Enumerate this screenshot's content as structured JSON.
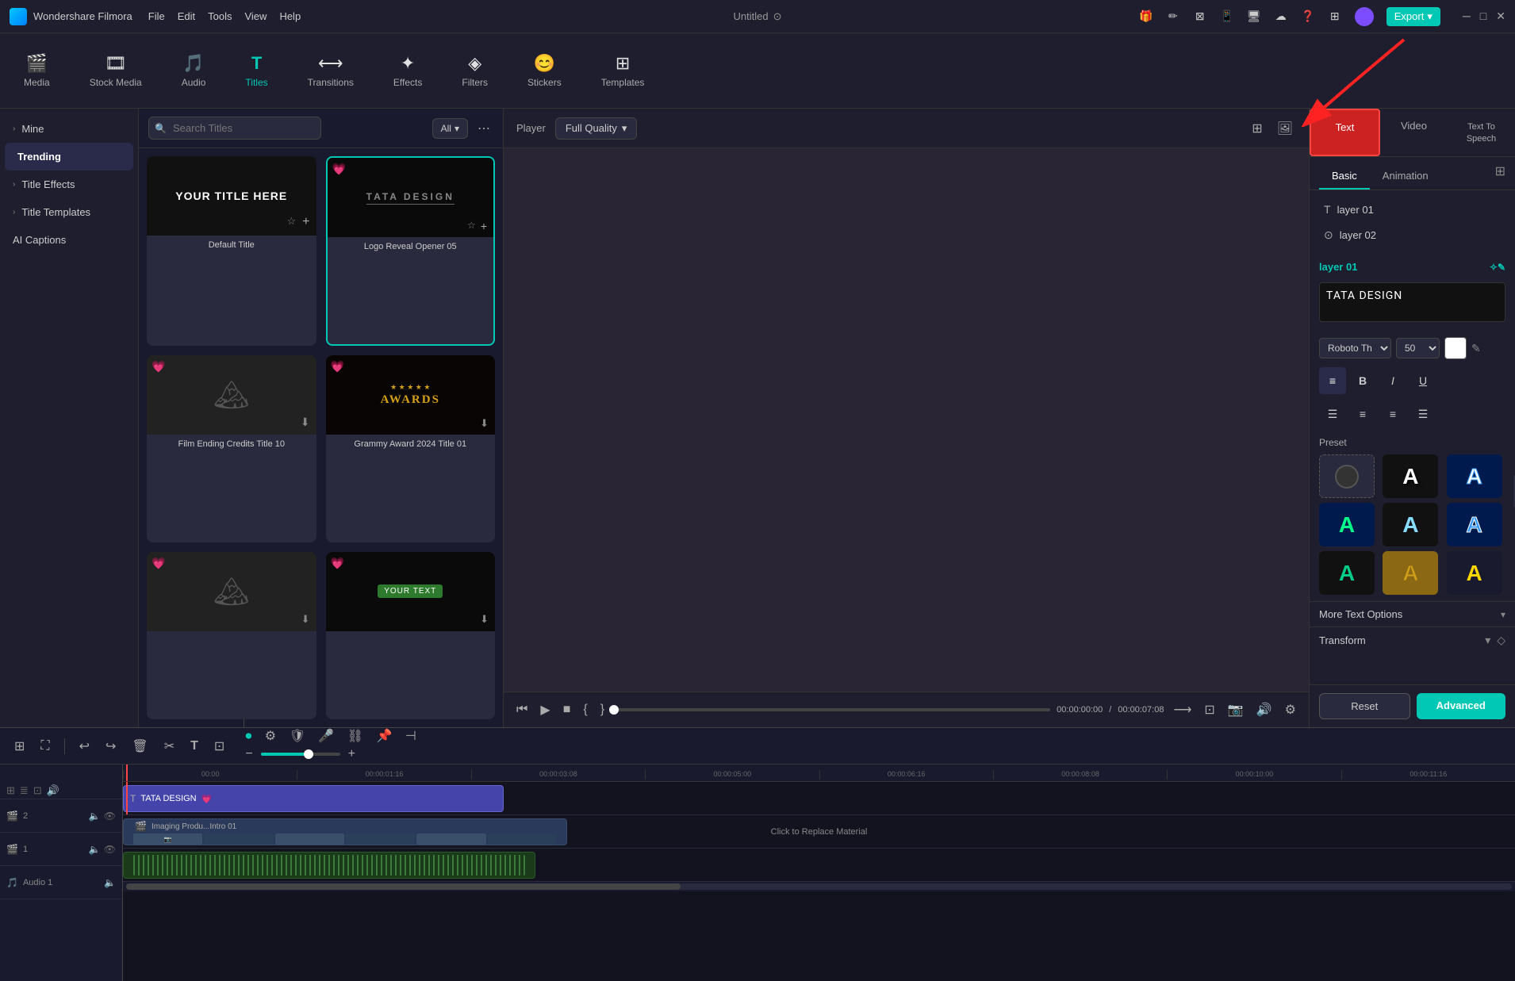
{
  "app": {
    "name": "Wondershare Filmora",
    "title": "Untitled"
  },
  "titlebar": {
    "menu": [
      "File",
      "Edit",
      "Tools",
      "View",
      "Help"
    ],
    "export_label": "Export"
  },
  "toolbar": {
    "items": [
      {
        "id": "media",
        "label": "Media",
        "icon": "🎬"
      },
      {
        "id": "stock",
        "label": "Stock Media",
        "icon": "🎞"
      },
      {
        "id": "audio",
        "label": "Audio",
        "icon": "🎵"
      },
      {
        "id": "titles",
        "label": "Titles",
        "icon": "T",
        "active": true
      },
      {
        "id": "transitions",
        "label": "Transitions",
        "icon": "⟷"
      },
      {
        "id": "effects",
        "label": "Effects",
        "icon": "✦"
      },
      {
        "id": "filters",
        "label": "Filters",
        "icon": "◈"
      },
      {
        "id": "stickers",
        "label": "Stickers",
        "icon": "😊"
      },
      {
        "id": "templates",
        "label": "Templates",
        "icon": "⊞"
      }
    ]
  },
  "left_panel": {
    "items": [
      {
        "id": "mine",
        "label": "Mine",
        "has_arrow": true
      },
      {
        "id": "trending",
        "label": "Trending",
        "active": true
      },
      {
        "id": "title_effects",
        "label": "Title Effects",
        "has_arrow": true
      },
      {
        "id": "title_templates",
        "label": "Title Templates",
        "has_arrow": true
      },
      {
        "id": "ai_captions",
        "label": "AI Captions"
      }
    ]
  },
  "titles_browser": {
    "search_placeholder": "Search Titles",
    "filter_label": "All",
    "cards": [
      {
        "id": "default",
        "label": "Default Title",
        "has_heart": false,
        "has_more": false,
        "style": "default"
      },
      {
        "id": "logo_reveal",
        "label": "Logo Reveal Opener 05",
        "has_heart": true,
        "selected": true,
        "style": "logo_reveal"
      },
      {
        "id": "film_ending",
        "label": "Film Ending Credits Title 10",
        "has_heart": true,
        "style": "mountains"
      },
      {
        "id": "grammy",
        "label": "Grammy Award 2024 Title 01",
        "has_heart": true,
        "style": "awards"
      },
      {
        "id": "card5",
        "label": "",
        "has_heart": true,
        "style": "mountains2"
      },
      {
        "id": "card6",
        "label": "",
        "has_heart": true,
        "style": "text_bar"
      }
    ]
  },
  "player": {
    "label": "Player",
    "quality_label": "Full Quality",
    "time_current": "00:00:00:00",
    "time_total": "00:00:07:08"
  },
  "right_panel": {
    "tabs": [
      "Text",
      "Video",
      "Text To Speech"
    ],
    "active_tab": "Text",
    "sub_tabs": [
      "Basic",
      "Animation"
    ],
    "active_sub_tab": "Basic",
    "layers": [
      {
        "id": "layer01",
        "label": "layer 01",
        "active": true,
        "icon": "T"
      },
      {
        "id": "layer02",
        "label": "layer 02",
        "active": false,
        "icon": "⊙"
      }
    ],
    "active_layer": "layer 01",
    "text_content": "TATA DESIGN",
    "font": "Roboto Th",
    "font_size": "50",
    "format_buttons": [
      "≡",
      "B",
      "I",
      "U"
    ],
    "align_buttons": [
      "left",
      "center",
      "right",
      "justify"
    ],
    "preset_section_label": "Preset",
    "more_text_label": "More Text Options",
    "transform_label": "Transform",
    "reset_label": "Reset",
    "advanced_label": "Advanced"
  },
  "timeline": {
    "tracks": [
      {
        "id": "track2",
        "label": "2",
        "icons": [
          "🎬",
          "🔈",
          "👁"
        ]
      },
      {
        "id": "track1",
        "label": "1",
        "icons": [
          "🎬",
          "🔈",
          "👁"
        ]
      },
      {
        "id": "audio1",
        "label": "Audio 1",
        "icons": [
          "🔈"
        ]
      }
    ],
    "title_clip_label": "TATA DESIGN",
    "video_clip_label": "Imaging Produ...Intro 01",
    "video_replace_label": "Click to Replace Material",
    "ruler_marks": [
      "00:00",
      "00:00:01:16",
      "00:00:03:08",
      "00:00:05:00",
      "00:00:06:16",
      "00:00:08:08",
      "00:00:10:00",
      "00:00:11:16"
    ]
  },
  "icons": {
    "search": "🔍",
    "heart": "💗",
    "more_vert": "⋯",
    "download": "⬇",
    "star": "☆",
    "plus": "+",
    "play": "▶",
    "pause": "⏸",
    "stop": "■",
    "skip_back": "⏮",
    "skip_fwd": "⏭",
    "camera": "📷",
    "volume": "🔊",
    "expand": "⤢",
    "chevron_down": "▾",
    "chevron_right": "›",
    "undo": "↩",
    "redo": "↪",
    "trash": "🗑",
    "cut": "✂",
    "text_t": "T",
    "crop": "⊡",
    "rotate": "↻",
    "split": "⊣",
    "grid": "⊞",
    "gear": "⚙",
    "shield": "🛡",
    "magnet": "🧲",
    "record": "⏺",
    "more": "⋮",
    "zoom_minus": "−",
    "zoom_plus": "+",
    "left_bracket": "{",
    "right_bracket": "}",
    "waveform": "〜",
    "fullscreen": "⛶",
    "minus_circle": "−",
    "plus_circle": "+",
    "eye": "👁",
    "lock": "🔒",
    "speaker": "🔊",
    "film": "🎬",
    "link": "⛓",
    "title_layer": "T",
    "layer_vis": "⊙",
    "edit": "✎",
    "ai": "✧"
  },
  "colors": {
    "accent": "#00c8b4",
    "highlight": "#cc2222",
    "title_clip_bg": "#4444aa",
    "active_tab_bg": "#cc2222",
    "selected_border": "#00c8b4"
  }
}
